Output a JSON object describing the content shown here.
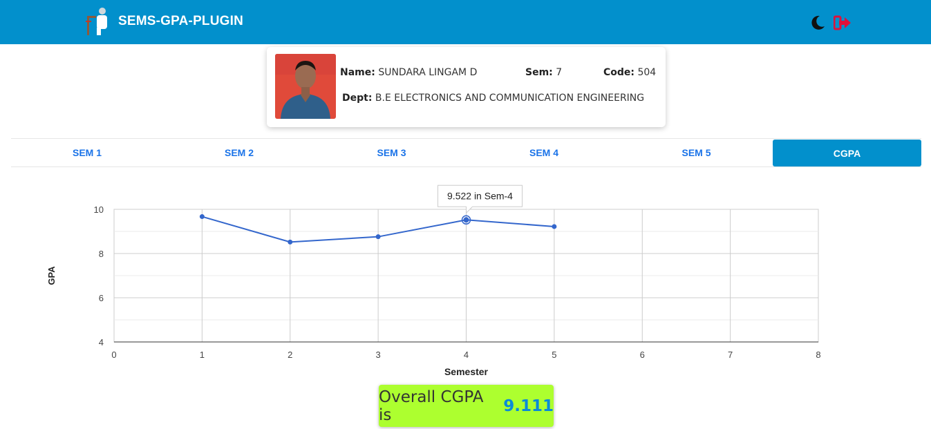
{
  "header": {
    "title": "SEMS-GPA-PLUGIN",
    "icons": {
      "logo": "person-at-desk-icon",
      "theme": "moon-icon",
      "logout": "sign-out-icon"
    },
    "colors": {
      "bar": "#0290cc",
      "logout": "#e0103a"
    }
  },
  "profile": {
    "name_label": "Name:",
    "name": "SUNDARA LINGAM D",
    "sem_label": "Sem:",
    "sem": "7",
    "code_label": "Code:",
    "code": "504",
    "dept_label": "Dept:",
    "dept": "B.E ELECTRONICS AND COMMUNICATION ENGINEERING"
  },
  "tabs": [
    {
      "label": "SEM 1",
      "active": false
    },
    {
      "label": "SEM 2",
      "active": false
    },
    {
      "label": "SEM 3",
      "active": false
    },
    {
      "label": "SEM 4",
      "active": false
    },
    {
      "label": "SEM 5",
      "active": false
    },
    {
      "label": "CGPA",
      "active": true
    }
  ],
  "chart_data": {
    "type": "line",
    "xlabel": "Semester",
    "ylabel": "GPA",
    "xlim": [
      0,
      8
    ],
    "ylim": [
      4,
      10
    ],
    "x_ticks": [
      "0",
      "1",
      "2",
      "3",
      "4",
      "5",
      "6",
      "7",
      "8"
    ],
    "y_ticks": [
      "4",
      "6",
      "8",
      "10"
    ],
    "grid": true,
    "series": [
      {
        "x": [
          1,
          2,
          3,
          4,
          5
        ],
        "y": [
          9.67,
          8.52,
          8.76,
          9.522,
          9.22
        ],
        "color": "#3366cc"
      }
    ],
    "tooltip": {
      "text": "9.522 in Sem-4",
      "point_index": 3
    }
  },
  "summary": {
    "prefix": "Overall CGPA is",
    "value": "9.111",
    "box_color": "#adff2f",
    "value_color": "#0a8ad8"
  }
}
